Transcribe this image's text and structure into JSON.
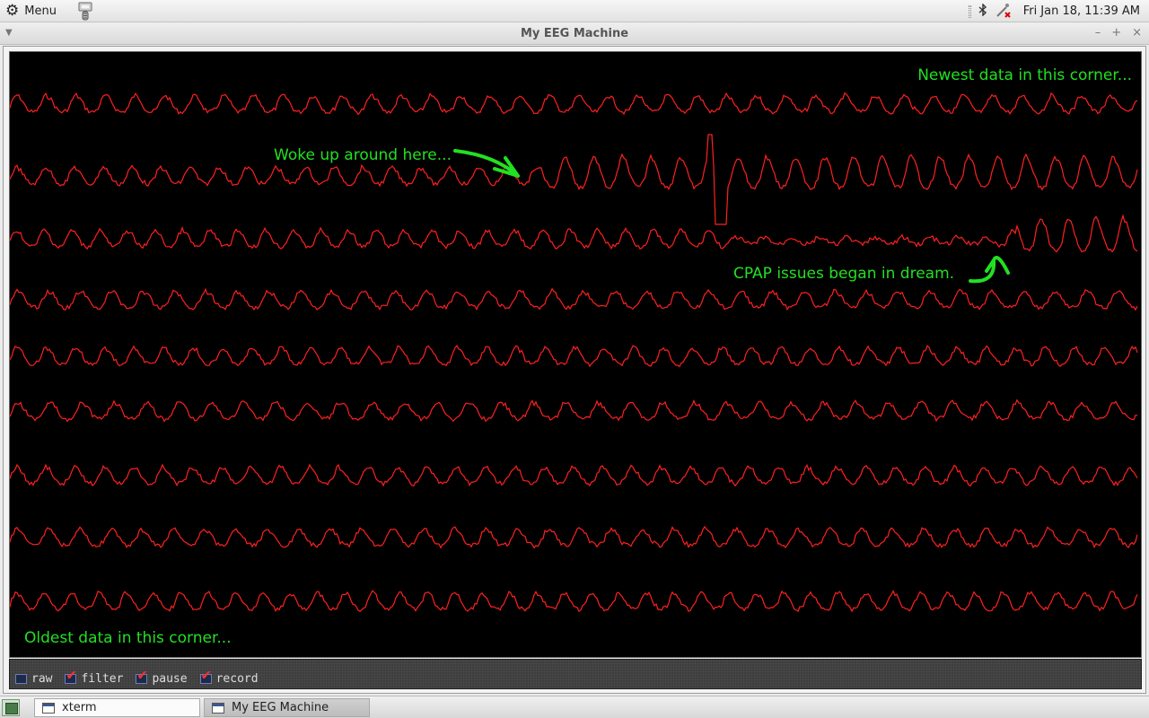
{
  "topbar": {
    "menu_label": "Menu",
    "clock": "Fri Jan 18, 11:39 AM",
    "icons": [
      "gear-icon",
      "launcher-icon",
      "bluetooth-icon",
      "network-disconnected-icon"
    ]
  },
  "window": {
    "title": "My EEG Machine",
    "buttons": [
      "minimize",
      "maximize",
      "close"
    ]
  },
  "eeg": {
    "trace_color": "#ff2020",
    "annotation_color": "#22e022",
    "rows": 9,
    "annotations": {
      "newest": "Newest data in this corner...",
      "woke": "Woke up around here...",
      "cpap": "CPAP issues began in dream.",
      "oldest": "Oldest data in this corner..."
    }
  },
  "controls": [
    {
      "label": "raw",
      "checked": false
    },
    {
      "label": "filter",
      "checked": true
    },
    {
      "label": "pause",
      "checked": true
    },
    {
      "label": "record",
      "checked": true
    }
  ],
  "taskbar": {
    "tasks": [
      {
        "label": "xterm"
      },
      {
        "label": "My EEG Machine"
      }
    ]
  }
}
